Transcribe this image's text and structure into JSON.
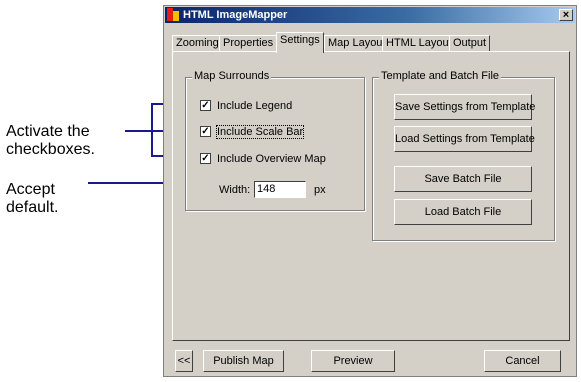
{
  "callouts": {
    "activate_line1": "Activate the",
    "activate_line2": "checkboxes.",
    "accept_line1": "Accept",
    "accept_line2": "default."
  },
  "window": {
    "title": "HTML ImageMapper",
    "close_glyph": "×",
    "title_color": "#0a246a"
  },
  "tabs": [
    {
      "label": "Zooming"
    },
    {
      "label": "Properties"
    },
    {
      "label": "Settings",
      "active": true
    },
    {
      "label": "Map Layout"
    },
    {
      "label": "HTML Layout"
    },
    {
      "label": "Output"
    }
  ],
  "map_surrounds": {
    "title": "Map Surrounds",
    "checkboxes": [
      {
        "label": "Include Legend",
        "checked": true
      },
      {
        "label": "Include Scale Bar",
        "checked": true
      },
      {
        "label": "Include Overview Map",
        "checked": true
      }
    ],
    "width_label": "Width:",
    "width_value": "148",
    "width_unit": "px"
  },
  "template_batch": {
    "title": "Template and Batch File",
    "buttons": [
      {
        "label": "Save Settings from Template"
      },
      {
        "label": "Load Settings from Template"
      },
      {
        "label": "Save Batch File"
      },
      {
        "label": "Load Batch File"
      }
    ]
  },
  "footer": {
    "back_label": "<<",
    "publish_label": "Publish Map",
    "preview_label": "Preview",
    "cancel_label": "Cancel"
  },
  "check_glyph": "✓",
  "callout_line_color": "#1a1a8c"
}
